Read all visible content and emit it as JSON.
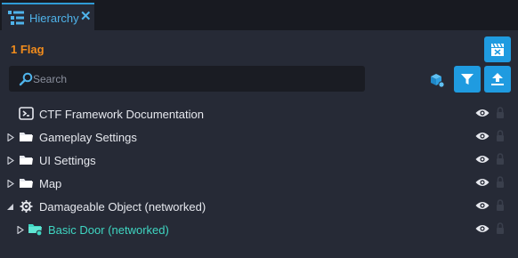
{
  "tab": {
    "label": "Hierarchy",
    "close": "✕"
  },
  "panel": {
    "selection_count": "1 Flag",
    "search": {
      "placeholder": "Search",
      "value": ""
    }
  },
  "tree": [
    {
      "label": "CTF Framework Documentation",
      "icon": "script-icon",
      "expandable": false,
      "expanded": false,
      "visible": true,
      "locked": false
    },
    {
      "label": "Gameplay Settings",
      "icon": "folder-icon",
      "expandable": true,
      "expanded": false,
      "visible": true,
      "locked": false
    },
    {
      "label": "UI Settings",
      "icon": "folder-icon",
      "expandable": true,
      "expanded": false,
      "visible": true,
      "locked": false
    },
    {
      "label": "Map",
      "icon": "folder-icon",
      "expandable": true,
      "expanded": false,
      "visible": true,
      "locked": false
    },
    {
      "label": "Damageable Object (networked)",
      "icon": "damageable-gear-icon",
      "expandable": true,
      "expanded": true,
      "visible": true,
      "locked": false
    },
    {
      "label": "Basic Door (networked)",
      "icon": "networked-folder-icon",
      "expandable": true,
      "expanded": false,
      "visible": true,
      "locked": false
    }
  ],
  "colors": {
    "accent": "#1f9be0",
    "tab_text": "#4fb3ea",
    "selection_count": "#f28c1c",
    "networked_child": "#3fd6c2",
    "panel_bg": "#262a36"
  }
}
